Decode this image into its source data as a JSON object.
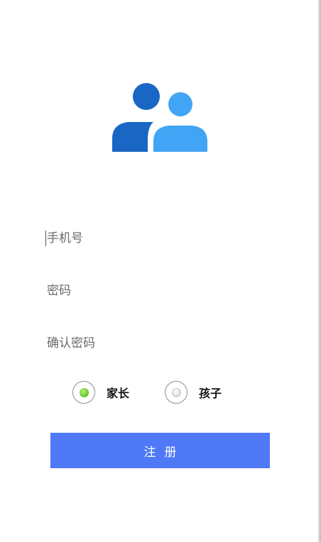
{
  "logo": {
    "icon": "users-icon",
    "colors": {
      "front_person": "#1a66c4",
      "back_person": "#42a4f5"
    }
  },
  "form": {
    "phone_placeholder": "手机号",
    "password_placeholder": "密码",
    "confirm_password_placeholder": "确认密码"
  },
  "role": {
    "options": [
      {
        "label": "家长",
        "selected": true
      },
      {
        "label": "孩子",
        "selected": false
      }
    ]
  },
  "register": {
    "label": "注册",
    "color": "#4f79f7"
  }
}
